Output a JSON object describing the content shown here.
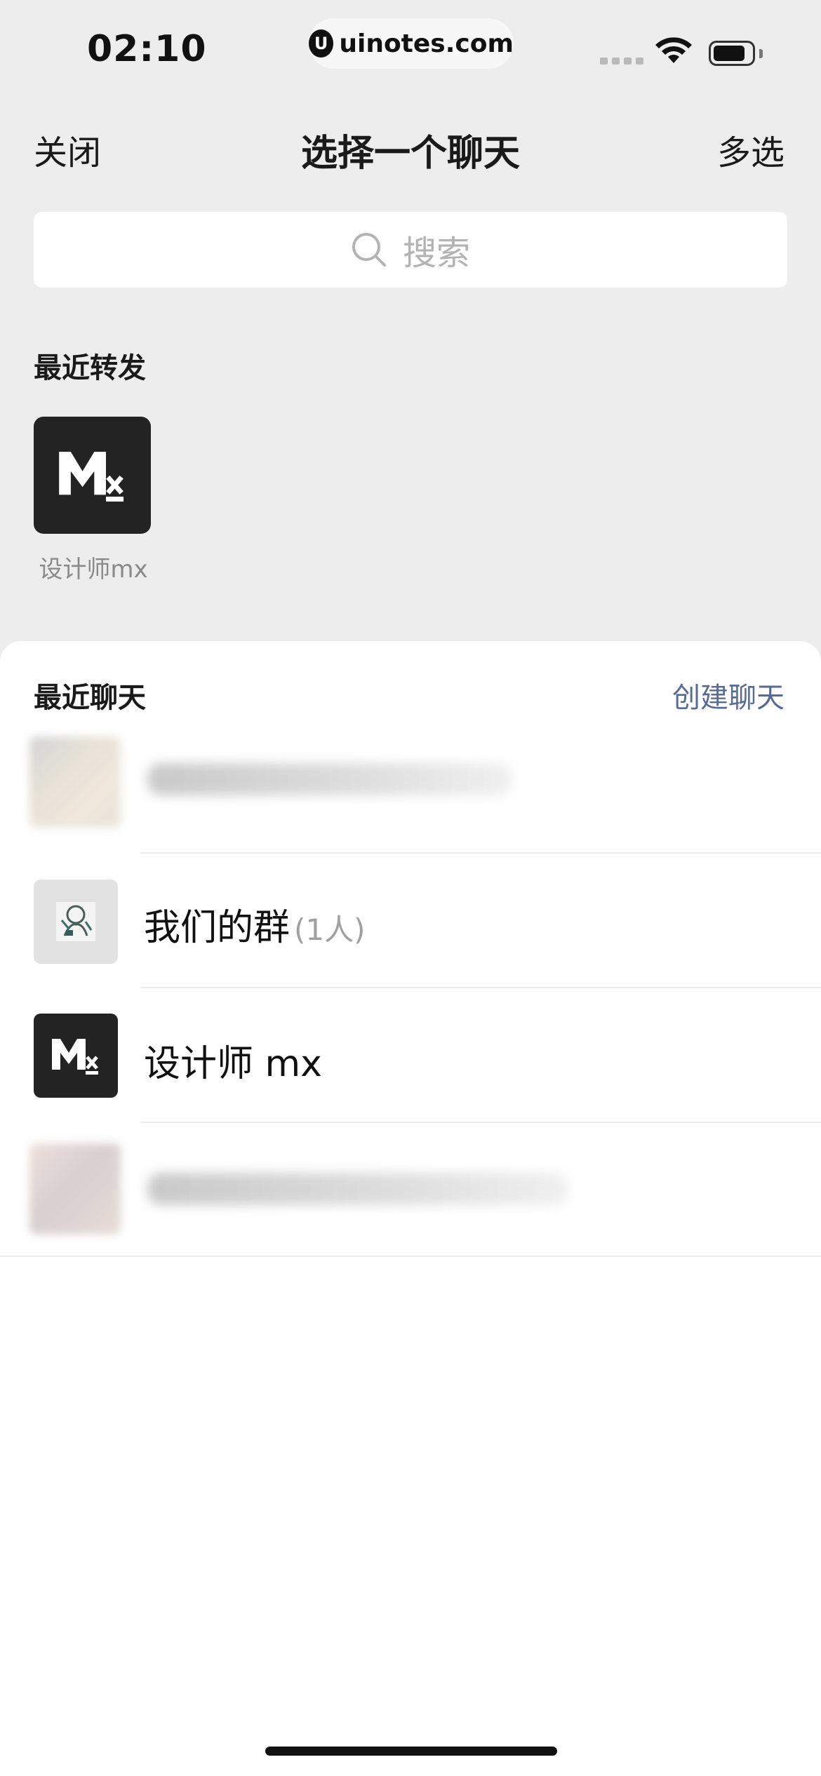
{
  "status_bar": {
    "time": "02:10",
    "site_badge": "uinotes.com"
  },
  "nav": {
    "close_label": "关闭",
    "title": "选择一个聊天",
    "multi_select_label": "多选"
  },
  "search": {
    "placeholder": "搜索"
  },
  "recent_forward": {
    "header": "最近转发",
    "contacts": [
      {
        "name": "设计师mx",
        "avatar": "mx-logo"
      }
    ]
  },
  "recent_chats": {
    "header": "最近聊天",
    "create_label": "创建聊天",
    "items": [
      {
        "name": "",
        "count": "",
        "avatar": "blurred-photo"
      },
      {
        "name": "我们的群",
        "count": "(1人)",
        "avatar": "sketch-figure"
      },
      {
        "name": "设计师 mx",
        "count": "",
        "avatar": "mx-logo"
      },
      {
        "name": "",
        "count": "",
        "avatar": "blurred-photo"
      }
    ]
  },
  "colors": {
    "background": "#ededed",
    "link": "#576b95",
    "avatar_dark": "#232323"
  }
}
